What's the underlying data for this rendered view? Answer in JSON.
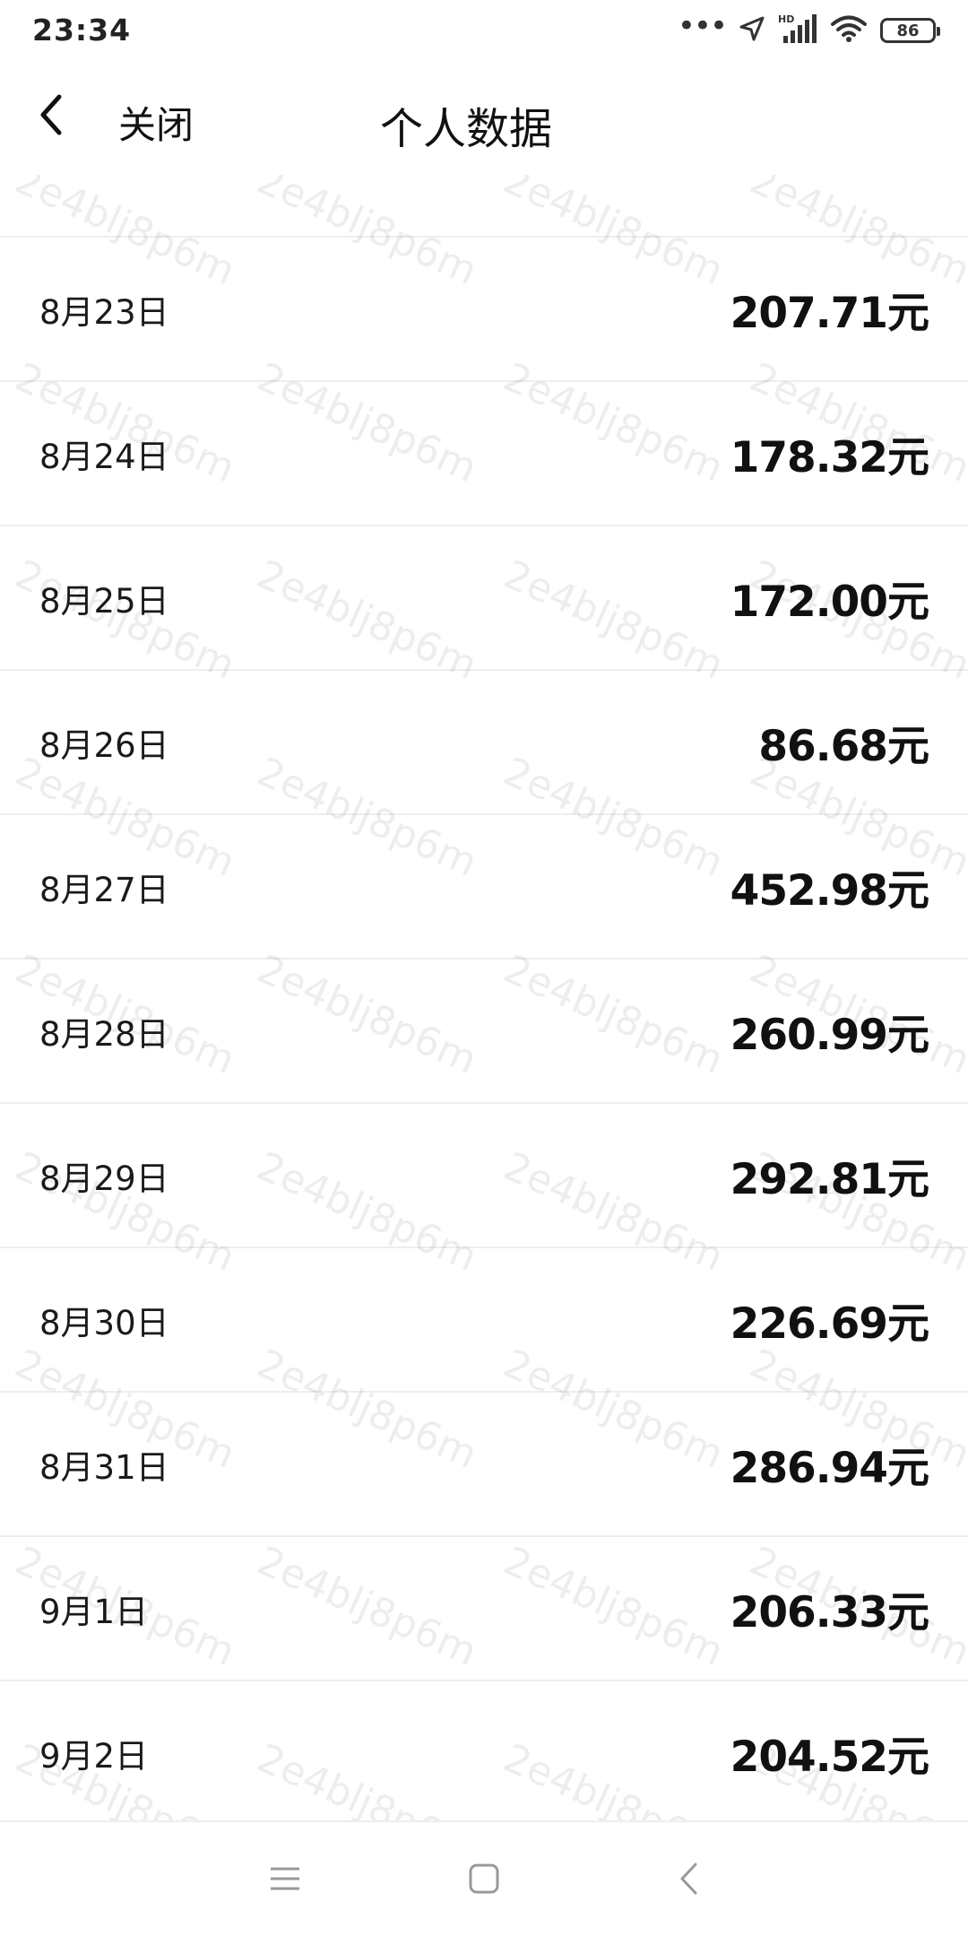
{
  "status_bar": {
    "time": "23:34",
    "battery_level": "86",
    "icons": [
      "more-dots-icon",
      "location-arrow-icon",
      "hd-signal-icon",
      "wifi-icon",
      "battery-icon"
    ]
  },
  "header": {
    "back_icon": "chevron-left-icon",
    "close_label": "关闭",
    "title": "个人数据"
  },
  "list": {
    "partial_amount": "",
    "rows": [
      {
        "date": "8月23日",
        "amount": "207.71元"
      },
      {
        "date": "8月24日",
        "amount": "178.32元"
      },
      {
        "date": "8月25日",
        "amount": "172.00元"
      },
      {
        "date": "8月26日",
        "amount": "86.68元"
      },
      {
        "date": "8月27日",
        "amount": "452.98元"
      },
      {
        "date": "8月28日",
        "amount": "260.99元"
      },
      {
        "date": "8月29日",
        "amount": "292.81元"
      },
      {
        "date": "8月30日",
        "amount": "226.69元"
      },
      {
        "date": "8月31日",
        "amount": "286.94元"
      },
      {
        "date": "9月1日",
        "amount": "206.33元"
      },
      {
        "date": "9月2日",
        "amount": "204.52元"
      }
    ]
  },
  "watermark": {
    "text": "2e4blj8p6m"
  },
  "bottom_nav": {
    "icons": [
      "menu-icon",
      "home-square-icon",
      "back-triangle-icon"
    ]
  }
}
